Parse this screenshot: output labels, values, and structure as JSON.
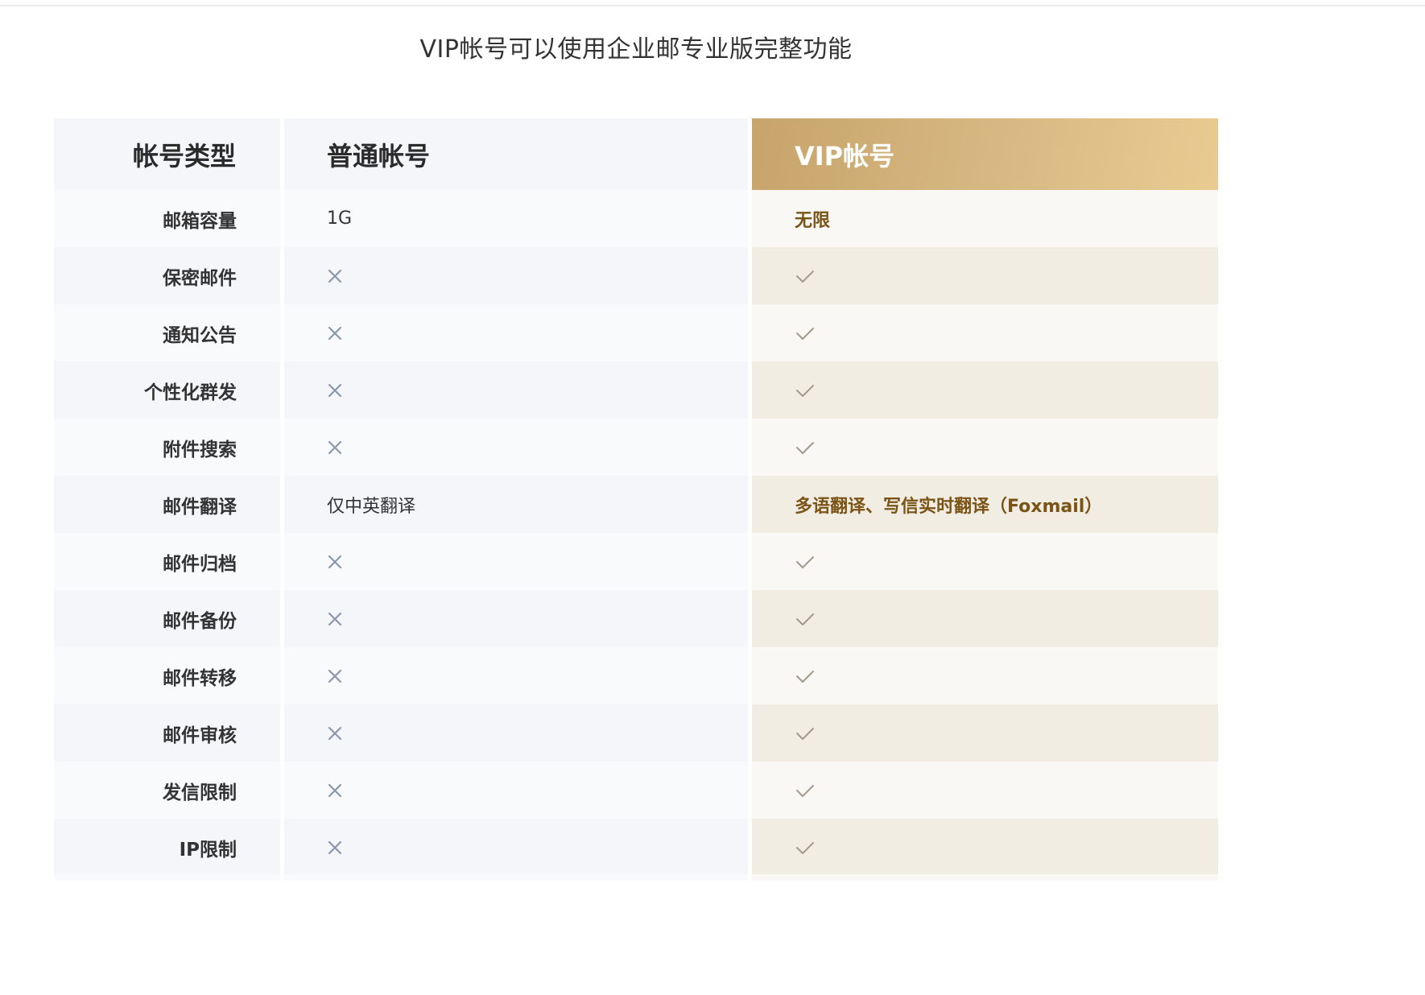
{
  "page": {
    "title": "VIP帐号可以使用企业邮专业版完整功能"
  },
  "table": {
    "header": {
      "type_label": "帐号类型",
      "normal_label": "普通帐号",
      "vip_label": "VIP帐号"
    },
    "rows": [
      {
        "feature": "邮箱容量",
        "normal": {
          "kind": "text",
          "text": "1G"
        },
        "vip": {
          "kind": "text",
          "text": "无限"
        }
      },
      {
        "feature": "保密邮件",
        "normal": {
          "kind": "cross"
        },
        "vip": {
          "kind": "check"
        }
      },
      {
        "feature": "通知公告",
        "normal": {
          "kind": "cross"
        },
        "vip": {
          "kind": "check"
        }
      },
      {
        "feature": "个性化群发",
        "normal": {
          "kind": "cross"
        },
        "vip": {
          "kind": "check"
        }
      },
      {
        "feature": "附件搜索",
        "normal": {
          "kind": "cross"
        },
        "vip": {
          "kind": "check"
        }
      },
      {
        "feature": "邮件翻译",
        "normal": {
          "kind": "text",
          "text": "仅中英翻译"
        },
        "vip": {
          "kind": "text",
          "text": "多语翻译、写信实时翻译（Foxmail）"
        }
      },
      {
        "feature": "邮件归档",
        "normal": {
          "kind": "cross"
        },
        "vip": {
          "kind": "check"
        }
      },
      {
        "feature": "邮件备份",
        "normal": {
          "kind": "cross"
        },
        "vip": {
          "kind": "check"
        }
      },
      {
        "feature": "邮件转移",
        "normal": {
          "kind": "cross"
        },
        "vip": {
          "kind": "check"
        }
      },
      {
        "feature": "邮件审核",
        "normal": {
          "kind": "cross"
        },
        "vip": {
          "kind": "check"
        }
      },
      {
        "feature": "发信限制",
        "normal": {
          "kind": "cross"
        },
        "vip": {
          "kind": "check"
        }
      },
      {
        "feature": "IP限制",
        "normal": {
          "kind": "cross"
        },
        "vip": {
          "kind": "check"
        }
      }
    ]
  },
  "icons": {
    "cross": "cross-icon",
    "check": "check-icon"
  },
  "colors": {
    "vip_header_gradient_start": "#c6a46b",
    "vip_header_gradient_end": "#e9cb92",
    "vip_text": "#7a5416",
    "cross_icon": "#8a97ad",
    "check_icon": "#a39a8c"
  }
}
